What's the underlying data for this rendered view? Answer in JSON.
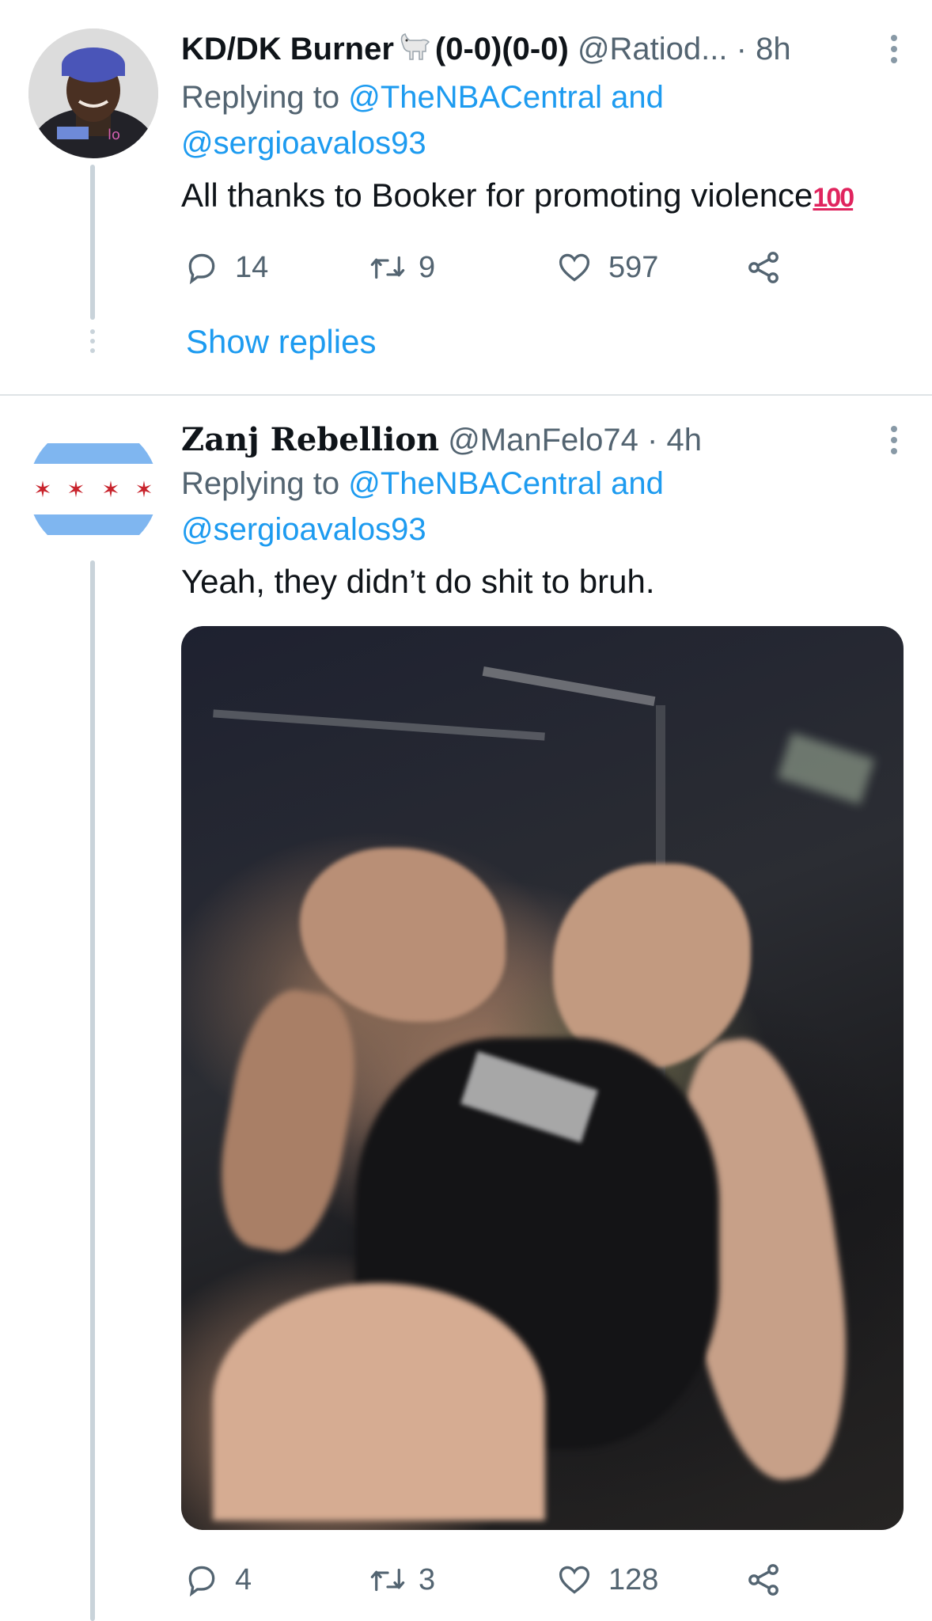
{
  "tweets": [
    {
      "display_name": "KD/DK Burner",
      "name_suffix": "(0-0)(0-0)",
      "handle": "@Ratiod...",
      "time": "· 8h",
      "replying_prefix": "Replying to",
      "replying_to_1": "@TheNBACentral and",
      "replying_to_2": "@sergioavalos93",
      "text": "All thanks to Booker for promoting violence",
      "emoji": "100",
      "reply_count": "14",
      "retweet_count": "9",
      "like_count": "597",
      "show_replies": "Show replies"
    },
    {
      "display_name": "Zanj Rebellion",
      "handle": "@ManFelo74",
      "time": "· 4h",
      "replying_prefix": "Replying to",
      "replying_to_1": "@TheNBACentral and",
      "replying_to_2": "@sergioavalos93",
      "text": "Yeah, they didn’t do shit to bruh.",
      "reply_count": "4",
      "retweet_count": "3",
      "like_count": "128"
    }
  ],
  "icons": {
    "reply": "reply-icon",
    "retweet": "retweet-icon",
    "like": "heart-icon",
    "share": "share-icon",
    "more": "more-vertical-icon",
    "goat": "goat-icon"
  },
  "colors": {
    "link": "#1d9bf0",
    "secondary_text": "#536471",
    "thread_line": "#c9d3da",
    "flag_blue": "#7fb6f0",
    "flag_star": "#c8232c",
    "emoji_red": "#e0245e"
  }
}
